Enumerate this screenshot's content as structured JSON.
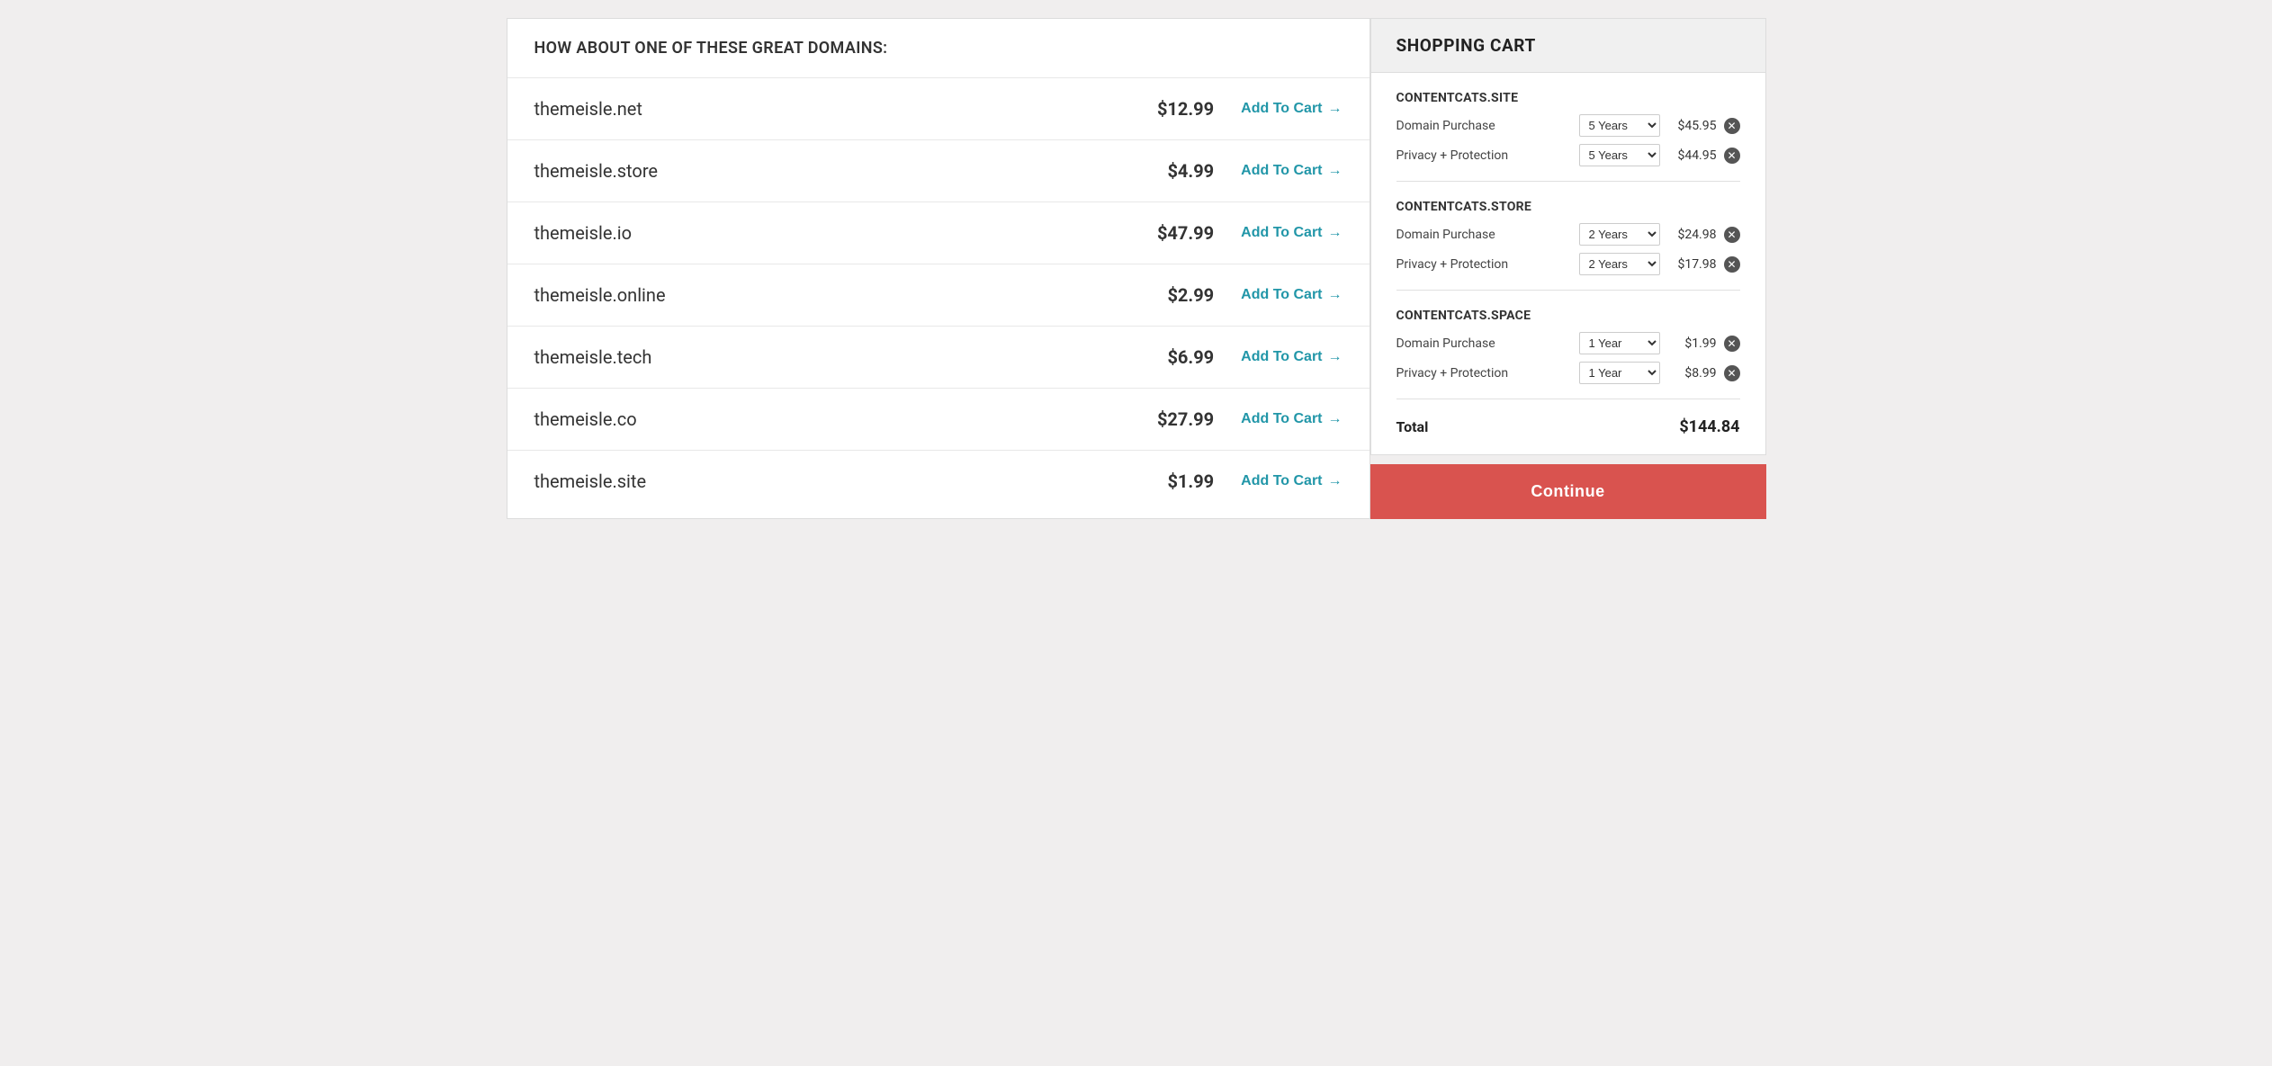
{
  "left_panel": {
    "header": "HOW ABOUT ONE OF THESE GREAT DOMAINS:",
    "domains": [
      {
        "name": "themeisle.net",
        "price": "$12.99",
        "add_label": "Add To Cart"
      },
      {
        "name": "themeisle.store",
        "price": "$4.99",
        "add_label": "Add To Cart"
      },
      {
        "name": "themeisle.io",
        "price": "$47.99",
        "add_label": "Add To Cart"
      },
      {
        "name": "themeisle.online",
        "price": "$2.99",
        "add_label": "Add To Cart"
      },
      {
        "name": "themeisle.tech",
        "price": "$6.99",
        "add_label": "Add To Cart"
      },
      {
        "name": "themeisle.co",
        "price": "$27.99",
        "add_label": "Add To Cart"
      },
      {
        "name": "themeisle.site",
        "price": "$1.99",
        "add_label": "Add To Cart"
      }
    ]
  },
  "cart": {
    "header": "SHOPPING CART",
    "groups": [
      {
        "domain_title": "CONTENTCATS.SITE",
        "items": [
          {
            "label": "Domain Purchase",
            "duration": "5 Years",
            "price": "$45.95"
          },
          {
            "label": "Privacy + Protection",
            "duration": "5 Years",
            "price": "$44.95"
          }
        ]
      },
      {
        "domain_title": "CONTENTCATS.STORE",
        "items": [
          {
            "label": "Domain Purchase",
            "duration": "2 Years",
            "price": "$24.98"
          },
          {
            "label": "Privacy + Protection",
            "duration": "2 Years",
            "price": "$17.98"
          }
        ]
      },
      {
        "domain_title": "CONTENTCATS.SPACE",
        "items": [
          {
            "label": "Domain Purchase",
            "duration": "1 Year",
            "price": "$1.99"
          },
          {
            "label": "Privacy + Protection",
            "duration": "1 Year",
            "price": "$8.99"
          }
        ]
      }
    ],
    "total_label": "Total",
    "total_price": "$144.84",
    "continue_label": "Continue"
  }
}
